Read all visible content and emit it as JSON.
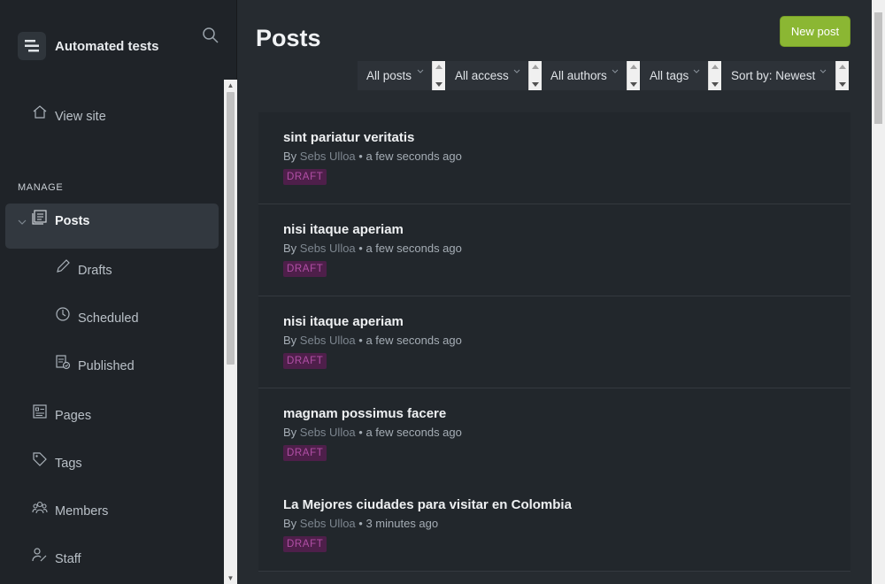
{
  "brand": {
    "title": "Automated tests",
    "icon": "ghost-logo-icon"
  },
  "sidebar": {
    "view_site": "View site",
    "section_manage": "MANAGE",
    "posts": "Posts",
    "drafts": "Drafts",
    "scheduled": "Scheduled",
    "published": "Published",
    "pages": "Pages",
    "tags": "Tags",
    "members": "Members",
    "staff": "Staff"
  },
  "main": {
    "title": "Posts",
    "new_post": "New post",
    "filters": {
      "type": "All posts",
      "access": "All access",
      "authors": "All authors",
      "tags": "All tags",
      "sort": "Sort by: Newest"
    },
    "posts": [
      {
        "title": "sint pariatur veritatis",
        "by": "By",
        "author": "Sebs Ulloa",
        "time": "• a few seconds ago",
        "status": "DRAFT"
      },
      {
        "title": "nisi itaque aperiam",
        "by": "By",
        "author": "Sebs Ulloa",
        "time": "• a few seconds ago",
        "status": "DRAFT"
      },
      {
        "title": "nisi itaque aperiam",
        "by": "By",
        "author": "Sebs Ulloa",
        "time": "• a few seconds ago",
        "status": "DRAFT"
      },
      {
        "title": "magnam possimus facere",
        "by": "By",
        "author": "Sebs Ulloa",
        "time": "• a few seconds ago",
        "status": "DRAFT"
      },
      {
        "title": "La Mejores ciudades para visitar en Colombia",
        "by": "By",
        "author": "Sebs Ulloa",
        "time": "• 3 minutes ago",
        "status": "DRAFT"
      }
    ]
  },
  "colors": {
    "accent": "#8bb733",
    "draft_badge_bg": "#4e1f4a",
    "draft_badge_text": "#b14fa6"
  }
}
